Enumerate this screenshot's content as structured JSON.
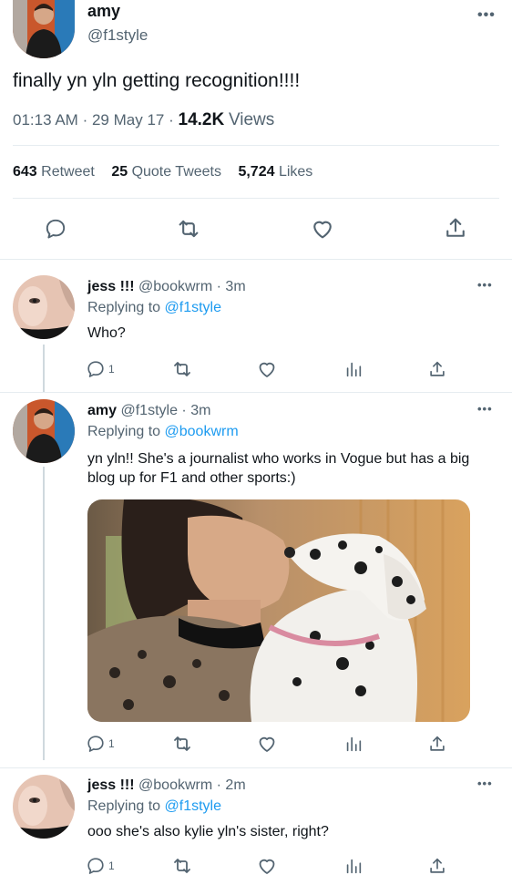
{
  "main_tweet": {
    "name": "amy",
    "handle": "@f1style",
    "text": "finally yn yln getting recognition!!!!",
    "time": "01:13 AM",
    "date": "29 May 17",
    "views_count": "14.2K",
    "views_label": "Views",
    "retweets_count": "643",
    "retweets_label": "Retweet",
    "quotes_count": "25",
    "quotes_label": "Quote Tweets",
    "likes_count": "5,724",
    "likes_label": "Likes"
  },
  "replies": [
    {
      "name": "jess !!!",
      "handle": "@bookwrm",
      "age": "3m",
      "replying_prefix": "Replying to",
      "replying_to": "@f1style",
      "text": "Who?",
      "reply_count": "1"
    },
    {
      "name": "amy",
      "handle": "@f1style",
      "age": "3m",
      "replying_prefix": "Replying to",
      "replying_to": "@bookwrm",
      "text": "yn yln!! She's a journalist who works in Vogue but has a big blog up for F1 and other sports:)",
      "reply_count": "1"
    },
    {
      "name": "jess !!!",
      "handle": "@bookwrm",
      "age": "2m",
      "replying_prefix": "Replying to",
      "replying_to": "@f1style",
      "text": "ooo she's also kylie yln's sister, right?",
      "reply_count": "1"
    }
  ],
  "separator": "·",
  "colors": {
    "accent": "#1d9bf0",
    "muted": "#536471",
    "divider": "#e6ecf0"
  },
  "icons": [
    "more-icon",
    "reply-icon",
    "retweet-icon",
    "like-icon",
    "share-icon",
    "analytics-icon"
  ]
}
